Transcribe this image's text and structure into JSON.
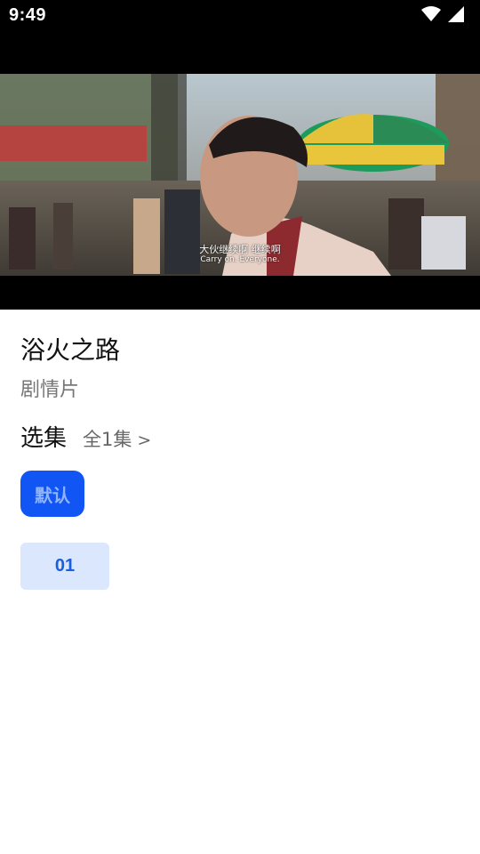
{
  "status_bar": {
    "time": "9:49",
    "icons": [
      "wifi-icon",
      "signal-icon"
    ]
  },
  "player": {
    "subtitle_cn": "大伙继续啊 继续啊",
    "subtitle_en": "Carry on. Everyone."
  },
  "detail": {
    "title": "浴火之路",
    "genre": "剧情片"
  },
  "episodes": {
    "label": "选集",
    "count_text": "全1集",
    "arrow": ">",
    "source_tab": "默认",
    "items": [
      "01"
    ]
  },
  "colors": {
    "accent": "#1156f5",
    "episode_bg": "#dbe7fd",
    "episode_text": "#1a5fe0"
  }
}
